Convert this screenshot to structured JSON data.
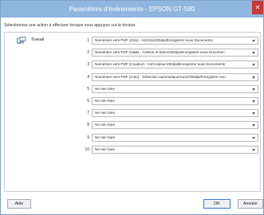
{
  "window": {
    "title": "Paramètres d'événements - EPSON GT-S80",
    "close_glyph": "✕"
  },
  "instruction": "Sélectionnez une action à effectuer lorsque vous appuyez sur le bouton.",
  "job": {
    "icon": "scanner-job-icon",
    "label": "Travail"
  },
  "rows": [
    {
      "num": "1",
      "value": "Numériser vers PDF (Gris) - A4/Gris/200dpi/Enregistrer sous Documents"
    },
    {
      "num": "2",
      "value": "Numériser vers PDF (N&B) - A4/Noir et blanc/300dpi/Enregistrer sous Documen"
    },
    {
      "num": "3",
      "value": "Numériser vers PDF (Couleur) - A4/Couleur/200dpi/Enregistrer sous Documents"
    },
    {
      "num": "4",
      "value": "Numériser vers PDF (Auto) - Détection automatique/Auto/200dpi/Enregistrer sou"
    },
    {
      "num": "5",
      "value": "Ne rien faire"
    },
    {
      "num": "6",
      "value": "Ne rien faire"
    },
    {
      "num": "7",
      "value": "Ne rien faire"
    },
    {
      "num": "8",
      "value": "Ne rien faire"
    },
    {
      "num": "9",
      "value": "Ne rien faire"
    },
    {
      "num": "10",
      "value": "Ne rien faire"
    }
  ],
  "buttons": {
    "help": "Aide",
    "ok": "OK",
    "cancel": "Annuler"
  },
  "colors": {
    "titlebar": "#8fb6df",
    "close": "#c43a3a",
    "ok_border": "#3b7dd8"
  }
}
